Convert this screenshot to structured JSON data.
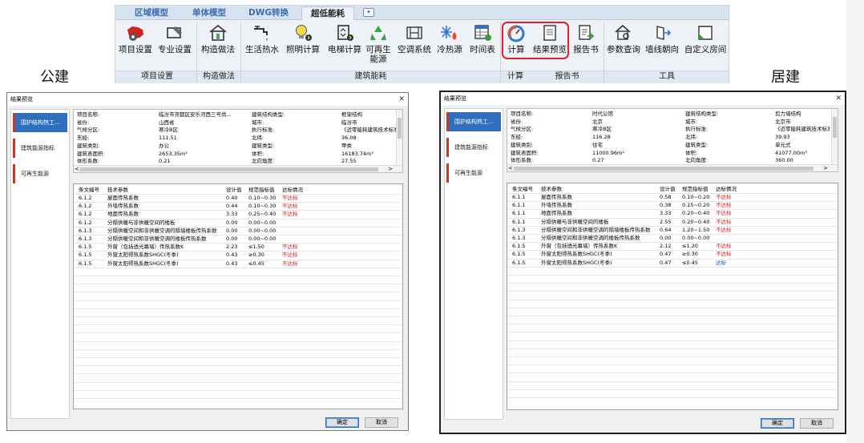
{
  "ribbon": {
    "tabs": [
      "区域模型",
      "单体模型",
      "DWG转换",
      "超低能耗"
    ],
    "active_tab": "超低能耗",
    "buttons": {
      "project_settings": "项目设置",
      "major_settings": "专业设置",
      "construction": "构造做法",
      "hot_water": "生活热水",
      "lighting_calc": "照明计算",
      "elevator_calc": "电梯计算",
      "renewable_1": "可再生",
      "renewable_2": "能源",
      "hvac": "空调系统",
      "cold_heat_source": "冷热源",
      "schedule": "时间表",
      "calculate": "计算",
      "result_preview": "结果预览",
      "report": "报告书",
      "param_query": "参数查询",
      "wall_orientation": "墙线朝向",
      "custom_room": "自定义房间"
    },
    "groups": {
      "project_settings": "项目设置",
      "construction": "构造做法",
      "building_energy": "建筑能耗",
      "calculate": "计算",
      "report": "报告书",
      "tools": "工具"
    }
  },
  "labels": {
    "public": "公建",
    "residential": "居建"
  },
  "dialog_common": {
    "title": "结果预览",
    "nav": [
      "围护结构热工...",
      "建筑能源指标",
      "可再生能源"
    ],
    "grid_headers": [
      "条文编号",
      "技术参数",
      "设计值",
      "规范指标值",
      "达标情况"
    ],
    "ok_label": "确定",
    "cancel_label": "取消",
    "scroll_left": "<",
    "scroll_right": ">"
  },
  "public_dialog": {
    "info": [
      {
        "k1": "项目名称:",
        "v1": "临汾市尧都区安乐河西三号尚...",
        "k2": "建筑结构类型:",
        "v2": "框架结构"
      },
      {
        "k1": "省份:",
        "v1": "山西省",
        "k2": "城市:",
        "v2": "临汾市"
      },
      {
        "k1": "气候分区:",
        "v1": "寒冷B区",
        "k2": "执行标准:",
        "v2": "《近零能耗建筑技术标准"
      },
      {
        "k1": "东经:",
        "v1": "111.51",
        "k2": "北纬:",
        "v2": "36.08"
      },
      {
        "k1": "建筑类别:",
        "v1": "办公",
        "k2": "建筑类型:",
        "v2": "甲类"
      },
      {
        "k1": "建筑表面积:",
        "v1": "2653.35m²",
        "k2": "体积:",
        "v2": "16183.74m³"
      },
      {
        "k1": "体形系数:",
        "v1": "0.21",
        "k2": "北向角度:",
        "v2": "27.55"
      }
    ],
    "rows": [
      {
        "code": "6.1.2",
        "param": "屋面传热系数",
        "design": "0.40",
        "limit": "0.10~0.30",
        "status": "不达标",
        "bad": true
      },
      {
        "code": "6.1.2",
        "param": "外墙传热系数",
        "design": "0.44",
        "limit": "0.10~0.30",
        "status": "不达标",
        "bad": true
      },
      {
        "code": "6.1.2",
        "param": "地面传热系数",
        "design": "3.33",
        "limit": "0.25~0.40",
        "status": "不达标",
        "bad": true
      },
      {
        "code": "6.1.2",
        "param": "分隔供暖与非供暖空间的楼板",
        "design": "0.00",
        "limit": "0.00~0.00",
        "status": "",
        "bad": false
      },
      {
        "code": "6.1.3",
        "param": "分隔供暖空间和非供暖空调的隔墙楼板传热系数",
        "design": "0.00",
        "limit": "0.00~0.00",
        "status": "",
        "bad": false
      },
      {
        "code": "6.1.3",
        "param": "分隔供暖空间和非供暖空调的楼板传热系数",
        "design": "0.00",
        "limit": "0.00~0.00",
        "status": "",
        "bad": false
      },
      {
        "code": "6.1.5",
        "param": "外窗（包括透光幕墙）传热系数K",
        "design": "2.23",
        "limit": "≤1.50",
        "status": "不达标",
        "bad": true
      },
      {
        "code": "6.1.5",
        "param": "外窗太阳得热系数SHGC(冬季)",
        "design": "0.43",
        "limit": "≥0.30",
        "status": "不达标",
        "bad": true
      },
      {
        "code": "6.1.5",
        "param": "外窗太阳得热系数SHGC(冬季)",
        "design": "0.43",
        "limit": "≤0.45",
        "status": "不达标",
        "bad": true
      }
    ]
  },
  "residential_dialog": {
    "info": [
      {
        "k1": "项目名称:",
        "v1": "时代公馆",
        "k2": "建筑结构类型:",
        "v2": "剪力墙结构"
      },
      {
        "k1": "省份:",
        "v1": "北京",
        "k2": "城市:",
        "v2": "北京市"
      },
      {
        "k1": "气候分区:",
        "v1": "寒冷B区",
        "k2": "执行标准:",
        "v2": "《近零能耗建筑技术标准"
      },
      {
        "k1": "东经:",
        "v1": "116.28",
        "k2": "北纬:",
        "v2": "39.93"
      },
      {
        "k1": "建筑类别:",
        "v1": "住宅",
        "k2": "建筑类型:",
        "v2": "单元式"
      },
      {
        "k1": "建筑表面积:",
        "v1": "11000.96m²",
        "k2": "体积:",
        "v2": "41077.00m³"
      },
      {
        "k1": "体形系数:",
        "v1": "0.27",
        "k2": "北向角度:",
        "v2": "360.00"
      }
    ],
    "rows": [
      {
        "code": "6.1.1",
        "param": "屋面传热系数",
        "design": "0.58",
        "limit": "0.10~0.20",
        "status": "不达标",
        "bad": true
      },
      {
        "code": "6.1.1",
        "param": "外墙传热系数",
        "design": "0.38",
        "limit": "0.15~0.20",
        "status": "不达标",
        "bad": true
      },
      {
        "code": "6.1.1",
        "param": "地面传热系数",
        "design": "3.33",
        "limit": "0.20~0.40",
        "status": "不达标",
        "bad": true
      },
      {
        "code": "6.1.1",
        "param": "分隔供暖与非供暖空间的楼板",
        "design": "2.55",
        "limit": "0.20~0.40",
        "status": "不达标",
        "bad": true
      },
      {
        "code": "6.1.3",
        "param": "分隔供暖空间和非供暖空调的隔墙楼板传热系数",
        "design": "0.64",
        "limit": "1.20~1.50",
        "status": "不达标",
        "bad": true
      },
      {
        "code": "6.1.3",
        "param": "分隔供暖空间和非供暖空调的楼板传热系数",
        "design": "0.00",
        "limit": "0.00~0.00",
        "status": "",
        "bad": false
      },
      {
        "code": "6.1.5",
        "param": "外窗（包括透光幕墙）传热系数K",
        "design": "2.12",
        "limit": "≤1.20",
        "status": "不达标",
        "bad": true
      },
      {
        "code": "6.1.5",
        "param": "外窗太阳得热系数SHGC(冬季)",
        "design": "0.47",
        "limit": "≥0.30",
        "status": "不达标",
        "bad": true
      },
      {
        "code": "6.1.5",
        "param": "外窗太阳得热系数SHGC(冬季)",
        "design": "0.47",
        "limit": "≤0.45",
        "status": "达标",
        "bad": false
      }
    ]
  },
  "colors": {
    "fail": "#d42020",
    "pass": "#1a4fc0",
    "nav_selected": "#2f6fbd",
    "highlight": "#e0202a"
  }
}
